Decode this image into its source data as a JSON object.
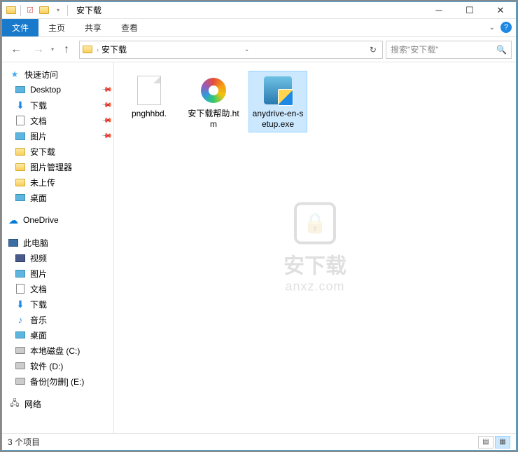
{
  "window": {
    "title": "安下载"
  },
  "ribbon": {
    "tabs": [
      "文件",
      "主页",
      "共享",
      "查看"
    ],
    "active_index": 0
  },
  "address": {
    "path": "安下载",
    "search_placeholder": "搜索\"安下载\""
  },
  "sidebar": {
    "quick_access": "快速访问",
    "quick_items": [
      {
        "label": "Desktop",
        "icon": "desktop",
        "pinned": true
      },
      {
        "label": "下载",
        "icon": "download",
        "pinned": true
      },
      {
        "label": "文档",
        "icon": "doc",
        "pinned": true
      },
      {
        "label": "图片",
        "icon": "pic",
        "pinned": true
      },
      {
        "label": "安下载",
        "icon": "folder",
        "pinned": false
      },
      {
        "label": "图片管理器",
        "icon": "folder",
        "pinned": false
      },
      {
        "label": "未上传",
        "icon": "folder",
        "pinned": false
      },
      {
        "label": "桌面",
        "icon": "desktop",
        "pinned": false
      }
    ],
    "onedrive": "OneDrive",
    "this_pc": "此电脑",
    "pc_items": [
      {
        "label": "视频",
        "icon": "video"
      },
      {
        "label": "图片",
        "icon": "pic"
      },
      {
        "label": "文档",
        "icon": "doc"
      },
      {
        "label": "下载",
        "icon": "download"
      },
      {
        "label": "音乐",
        "icon": "music"
      },
      {
        "label": "桌面",
        "icon": "desktop"
      },
      {
        "label": "本地磁盘 (C:)",
        "icon": "drive"
      },
      {
        "label": "软件 (D:)",
        "icon": "drive"
      },
      {
        "label": "备份[勿删] (E:)",
        "icon": "drive"
      }
    ],
    "network": "网络"
  },
  "files": [
    {
      "name": "pnghhbd.",
      "icon": "blank",
      "selected": false
    },
    {
      "name": "安下载帮助.htm",
      "icon": "colorwheel",
      "selected": false
    },
    {
      "name": "anydrive-en-setup.exe",
      "icon": "exe",
      "selected": true
    }
  ],
  "watermark": {
    "cn": "安下载",
    "en": "anxz.com"
  },
  "status": {
    "text": "3 个项目"
  }
}
